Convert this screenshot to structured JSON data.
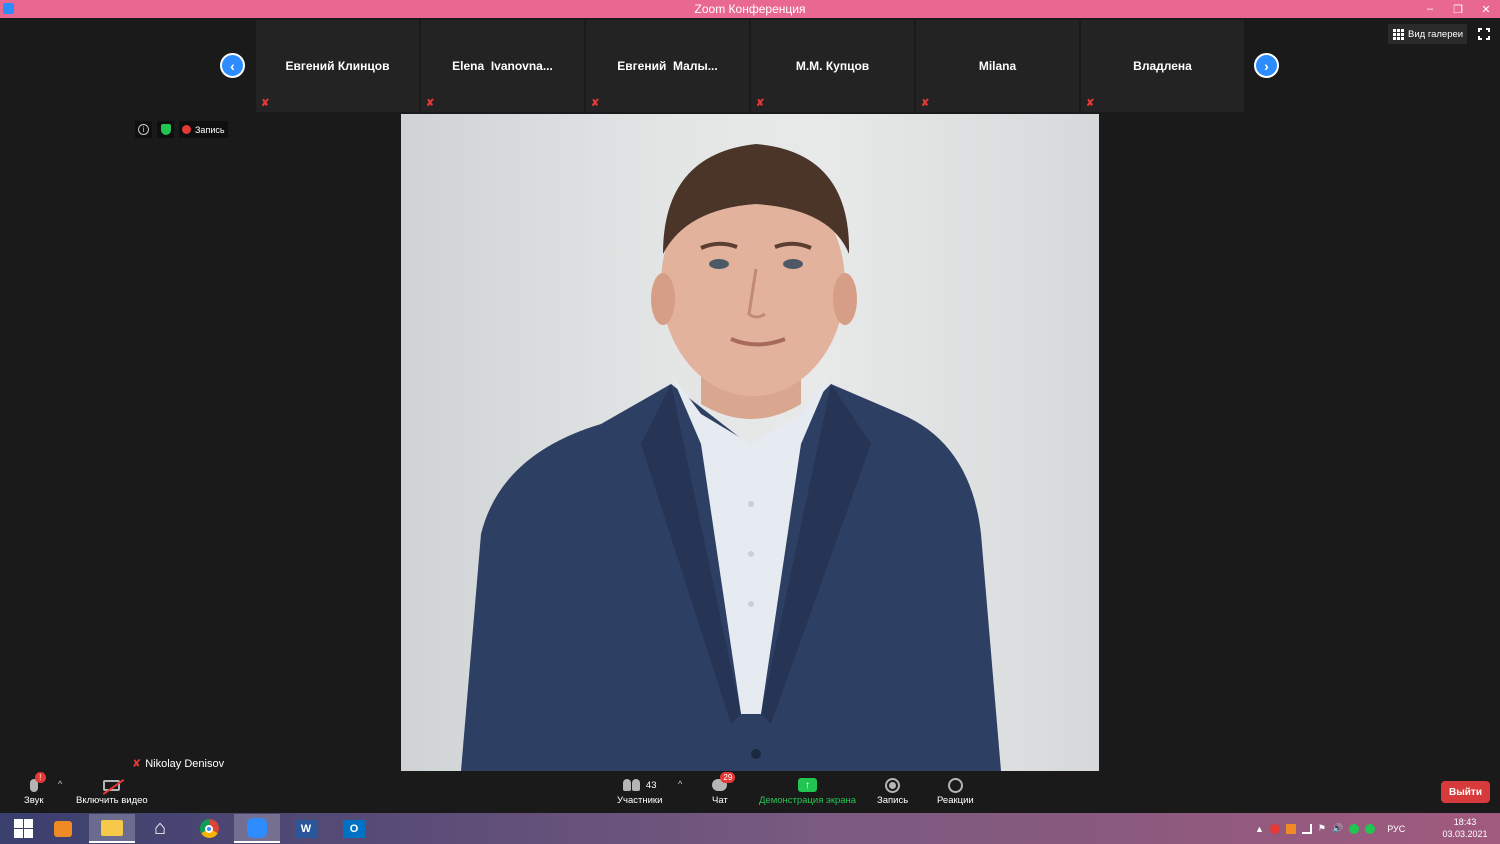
{
  "window": {
    "title": "Zoom Конференция"
  },
  "filmstrip": {
    "participants": [
      {
        "name": "Евгений Клинцов"
      },
      {
        "name": "Elena  Ivanovna..."
      },
      {
        "name": "Евгений  Малы..."
      },
      {
        "name": "М.М. Купцов"
      },
      {
        "name": "Milana"
      },
      {
        "name": "Владлена"
      }
    ]
  },
  "view": {
    "gallery_label": "Вид галереи"
  },
  "info": {
    "recording_label": "Запись",
    "info_icon": "i"
  },
  "speaker": {
    "name": "Nikolay Denisov"
  },
  "toolbar": {
    "audio_label": "Звук",
    "audio_badge": "!",
    "video_label": "Включить видео",
    "participants_label": "Участники",
    "participants_count": "43",
    "chat_label": "Чат",
    "chat_badge": "29",
    "share_label": "Демонстрация экрана",
    "record_label": "Запись",
    "reactions_label": "Реакции",
    "leave_label": "Выйти"
  },
  "taskbar": {
    "language": "РУС",
    "time": "18:43",
    "date": "03.03.2021"
  },
  "colors": {
    "titlebar": "#e8688f",
    "accent_blue": "#2d8cff",
    "share_green": "#23c552",
    "leave_red": "#d63a3a"
  }
}
